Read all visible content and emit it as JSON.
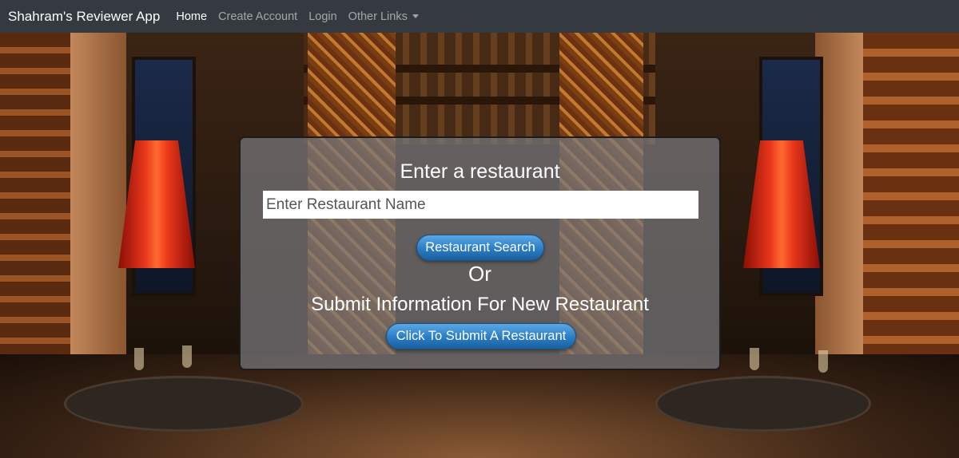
{
  "navbar": {
    "brand": "Shahram's Reviewer App",
    "links": [
      {
        "label": "Home",
        "active": true
      },
      {
        "label": "Create Account",
        "active": false
      },
      {
        "label": "Login",
        "active": false
      },
      {
        "label": "Other Links",
        "active": false,
        "dropdown": true
      }
    ],
    "dropdown_icon": "caret-down-icon"
  },
  "panel": {
    "title": "Enter a restaurant",
    "search_placeholder": "Enter Restaurant Name",
    "search_button": "Restaurant Search",
    "or_text": "Or",
    "submit_heading": "Submit Information For New Restaurant",
    "submit_button": "Click To Submit A Restaurant"
  },
  "colors": {
    "navbar_bg": "#343a40",
    "button_blue": "#2a7cc4",
    "panel_overlay": "#78787d"
  }
}
